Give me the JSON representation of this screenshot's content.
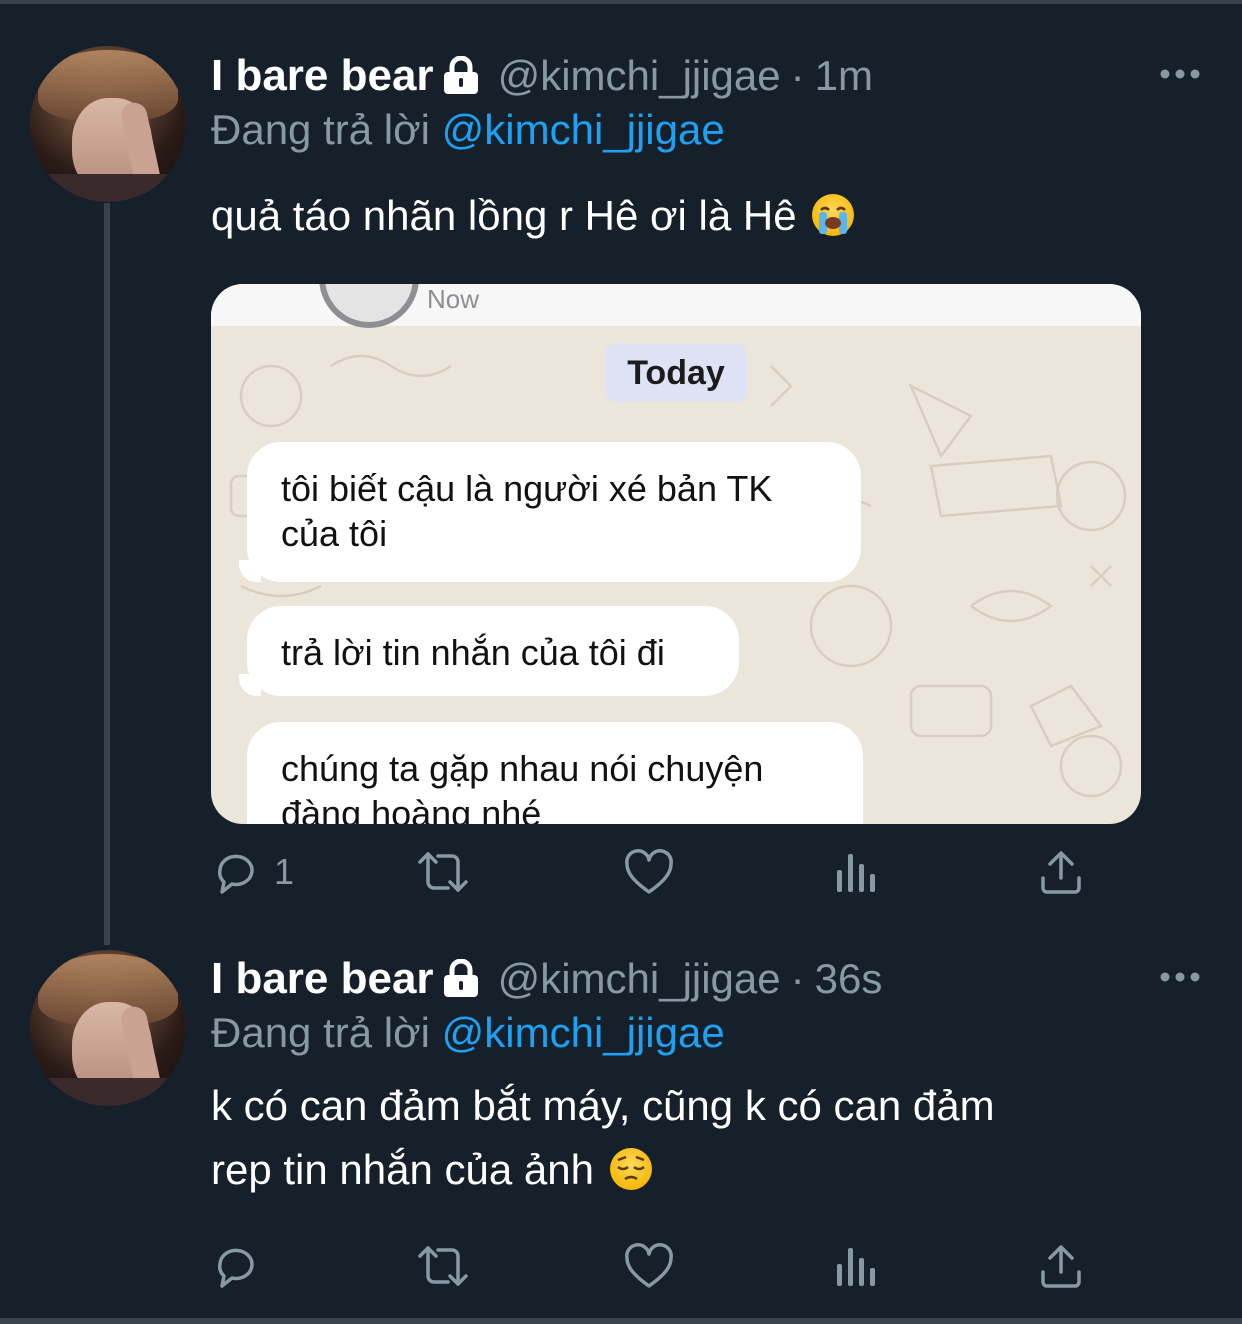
{
  "tweets": [
    {
      "display_name": "I bare bear",
      "handle": "@kimchi_jjigae",
      "separator": "·",
      "time": "1m",
      "replying_prefix": "Đang trả lời",
      "replying_to": "@kimchi_jjigae",
      "text": "quả táo nhãn lồng r Hê ơi là Hê",
      "emoji": "loudly-crying-face",
      "reply_count": "1",
      "media": {
        "status_text": "Now",
        "date_pill": "Today",
        "messages": [
          "tôi biết cậu là người xé bản TK của tôi",
          "trả lời tin nhắn của tôi đi",
          "chúng ta gặp nhau nói chuyện đàng hoàng nhé"
        ]
      }
    },
    {
      "display_name": "I bare bear",
      "handle": "@kimchi_jjigae",
      "separator": "·",
      "time": "36s",
      "replying_prefix": "Đang trả lời",
      "replying_to": "@kimchi_jjigae",
      "text_line1": "k có can đảm bắt máy, cũng k có can đảm",
      "text_line2": "rep tin nhắn của ảnh",
      "emoji": "pensive-face",
      "reply_count": ""
    }
  ],
  "colors": {
    "background": "#15202b",
    "secondary_text": "#8899a6",
    "link": "#1da1f2",
    "divider": "#38444d"
  },
  "icons": [
    "lock-icon",
    "more-icon",
    "reply-icon",
    "retweet-icon",
    "like-icon",
    "analytics-icon",
    "share-icon"
  ]
}
